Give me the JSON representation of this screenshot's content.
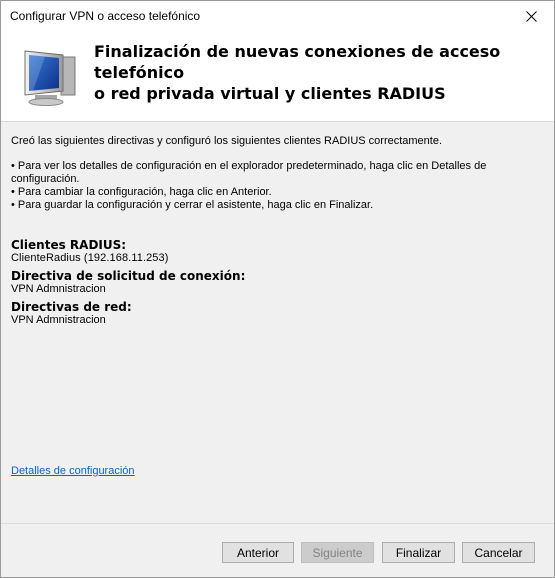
{
  "window": {
    "title": "Configurar VPN o acceso telefónico",
    "close_icon": "close-icon"
  },
  "header": {
    "title_line1": "Finalización de nuevas conexiones de acceso telefónico",
    "title_line2": "o red privada virtual y clientes RADIUS",
    "icon": "computer-monitor-icon"
  },
  "body": {
    "summary": "Creó las siguientes directivas y configuró los siguientes clientes RADIUS correctamente.",
    "bullets": [
      "Para ver los detalles de configuración en el explorador predeterminado, haga clic en Detalles de configuración.",
      "Para cambiar la configuración, haga clic en Anterior.",
      "Para guardar la configuración y cerrar el asistente, haga clic en Finalizar."
    ]
  },
  "sections": {
    "radius_label": "Clientes RADIUS:",
    "radius_value": "ClienteRadius (192.168.11.253)",
    "connection_policy_label": "Directiva de solicitud de conexión:",
    "connection_policy_value": "VPN Admnistracion",
    "network_policies_label": "Directivas de red:",
    "network_policies_value": "VPN Admnistracion"
  },
  "link": {
    "details": "Detalles de configuración"
  },
  "buttons": {
    "back": "Anterior",
    "next": "Siguiente",
    "finish": "Finalizar",
    "cancel": "Cancelar"
  },
  "colors": {
    "link": "#0066cc",
    "background": "#f0f0f0",
    "header_bg": "#ffffff"
  }
}
